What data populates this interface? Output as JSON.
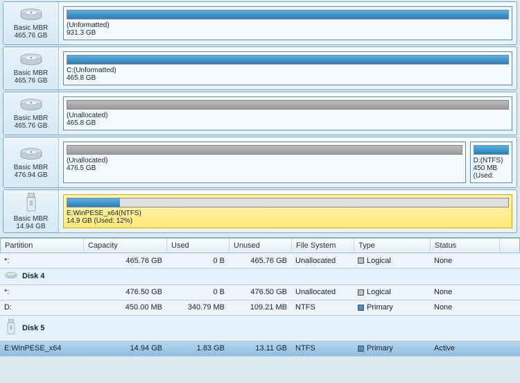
{
  "disks": [
    {
      "type": "Basic MBR",
      "size": "465.76 GB",
      "icon": "hdd",
      "partitions": [
        {
          "label": "(Unformatted)",
          "size": "931.3 GB",
          "barColor": "blue",
          "fillPct": 100,
          "flex": 1
        }
      ]
    },
    {
      "type": "Basic MBR",
      "size": "465.76 GB",
      "icon": "hdd",
      "partitions": [
        {
          "label": "C:(Unformatted)",
          "size": "465.8 GB",
          "barColor": "blue",
          "fillPct": 100,
          "flex": 1
        }
      ]
    },
    {
      "type": "Basic MBR",
      "size": "465.76 GB",
      "icon": "hdd",
      "partitions": [
        {
          "label": "(Unallocated)",
          "size": "465.8 GB",
          "barColor": "gray",
          "fillPct": 100,
          "flex": 1
        }
      ]
    },
    {
      "type": "Basic MBR",
      "size": "476.94 GB",
      "icon": "hdd",
      "partitions": [
        {
          "label": "(Unallocated)",
          "size": "476.5 GB",
          "barColor": "gray",
          "fillPct": 100,
          "flex": 1
        },
        {
          "label": "D:(NTFS)",
          "size": "450 MB (Used:",
          "barColor": "blue",
          "fillPct": 100,
          "flex": 0.09
        }
      ]
    },
    {
      "type": "Basic MBR",
      "size": "14.94 GB",
      "icon": "usb",
      "partitions": [
        {
          "label": "E:WinPESE_x64(NTFS)",
          "size": "14.9 GB (Used: 12%)",
          "barColor": "blue",
          "fillPct": 12,
          "flex": 1,
          "selected": true
        }
      ]
    }
  ],
  "columns": [
    "Partition",
    "Capacity",
    "Used",
    "Unused",
    "File System",
    "Type",
    "Status"
  ],
  "rows": [
    {
      "kind": "data",
      "cells": [
        "*:",
        "465.76 GB",
        "0 B",
        "465.76 GB",
        "Unallocated",
        "Logical",
        "None"
      ],
      "typeColor": "gray"
    },
    {
      "kind": "group",
      "label": "Disk 4",
      "icon": "hdd"
    },
    {
      "kind": "data",
      "cells": [
        "*:",
        "476.50 GB",
        "0 B",
        "476.50 GB",
        "Unallocated",
        "Logical",
        "None"
      ],
      "typeColor": "gray"
    },
    {
      "kind": "data",
      "cells": [
        "D:",
        "450.00 MB",
        "340.79 MB",
        "109.21 MB",
        "NTFS",
        "Primary",
        "None"
      ],
      "typeColor": "blue"
    },
    {
      "kind": "group",
      "label": "Disk 5",
      "icon": "usb"
    },
    {
      "kind": "data",
      "cells": [
        "E:WinPESE_x64",
        "14.94 GB",
        "1.83 GB",
        "13.11 GB",
        "NTFS",
        "Primary",
        "Active"
      ],
      "typeColor": "blue",
      "selected": true
    }
  ]
}
